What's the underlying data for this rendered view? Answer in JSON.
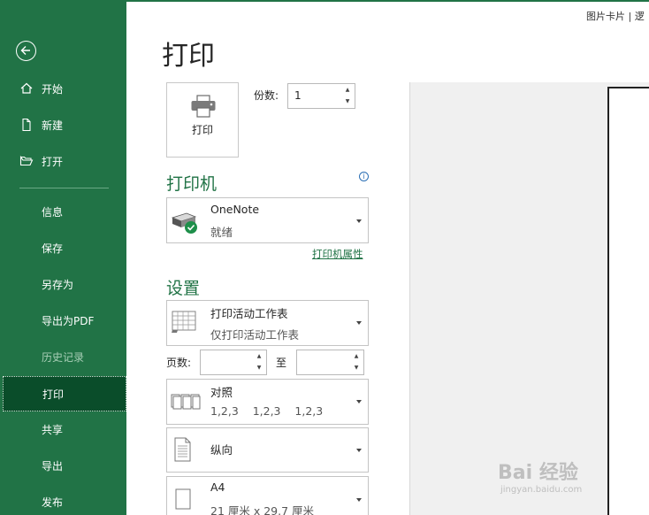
{
  "header": {
    "title": "打印",
    "top_right_text": "图片卡片 | 逻"
  },
  "sidebar": {
    "items": [
      {
        "label": "开始"
      },
      {
        "label": "新建"
      },
      {
        "label": "打开"
      },
      {
        "label": "信息"
      },
      {
        "label": "保存"
      },
      {
        "label": "另存为"
      },
      {
        "label": "导出为PDF"
      },
      {
        "label": "历史记录"
      },
      {
        "label": "打印"
      },
      {
        "label": "共享"
      },
      {
        "label": "导出"
      },
      {
        "label": "发布"
      }
    ]
  },
  "print": {
    "button_label": "打印",
    "copies_label": "份数:",
    "copies_value": "1"
  },
  "printer": {
    "heading": "打印机",
    "name": "OneNote",
    "status": "就绪",
    "properties_link": "打印机属性"
  },
  "settings": {
    "heading": "设置",
    "scope_title": "打印活动工作表",
    "scope_desc": "仅打印活动工作表",
    "pages_label": "页数:",
    "pages_from": "",
    "to_label": "至",
    "pages_to": "",
    "collate_title": "对照",
    "collate_desc": "1,2,3    1,2,3    1,2,3",
    "orientation_title": "纵向",
    "paper_title": "A4",
    "paper_desc": "21 厘米 x 29.7 厘米"
  },
  "watermark": {
    "main": "Bai 经验",
    "sub": "jingyan.baidu.com"
  },
  "colors": {
    "accent": "#217346",
    "active_nav": "#0a4d2a"
  }
}
